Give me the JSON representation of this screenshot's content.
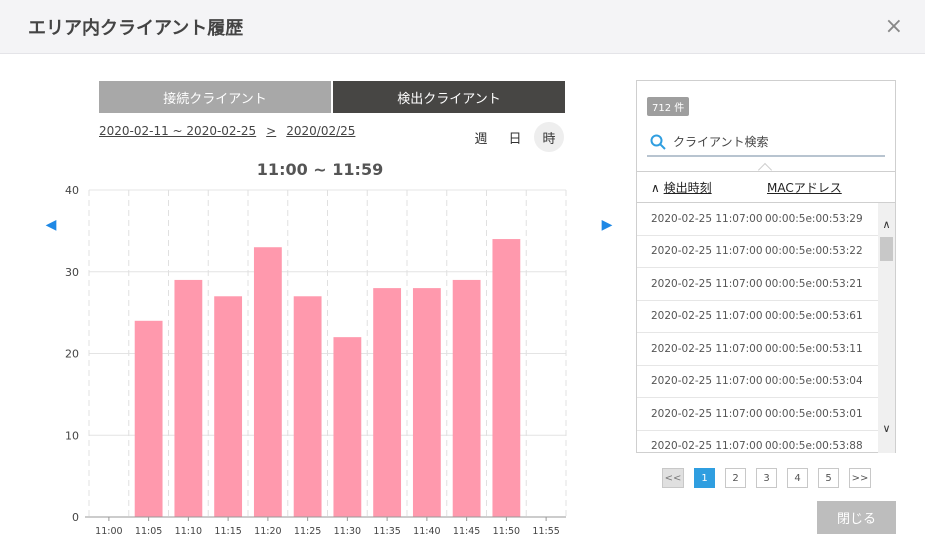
{
  "header": {
    "title": "エリア内クライアント履歴",
    "close_glyph": "×"
  },
  "tabs": [
    {
      "label": "接続クライアント",
      "active": false
    },
    {
      "label": "検出クライアント",
      "active": true
    }
  ],
  "daterange": {
    "range": "2020-02-11 ~ 2020-02-25",
    "separator": ">",
    "date": "2020/02/25"
  },
  "granularity": [
    {
      "label": "週",
      "active": false
    },
    {
      "label": "日",
      "active": false
    },
    {
      "label": "時",
      "active": true
    }
  ],
  "nav": {
    "prev_glyph": "◀",
    "next_glyph": "▶"
  },
  "chart_data": {
    "type": "bar",
    "title": "11:00 ~ 11:59",
    "categories": [
      "11:00",
      "11:05",
      "11:10",
      "11:15",
      "11:20",
      "11:25",
      "11:30",
      "11:35",
      "11:40",
      "11:45",
      "11:50",
      "11:55"
    ],
    "values": [
      0,
      24,
      29,
      27,
      33,
      27,
      22,
      28,
      28,
      29,
      34,
      0
    ],
    "yticks": [
      "0",
      "10",
      "20",
      "30",
      "40"
    ],
    "ylim": [
      0,
      40
    ],
    "xlabel": "",
    "ylabel": "",
    "grid": true,
    "bar_color": "#ff99ad"
  },
  "panel": {
    "count_badge": "712 件",
    "search_placeholder": "クライアント検索",
    "col_time_arrow": "∧",
    "col_time": "検出時刻",
    "col_mac": "MACアドレス",
    "rows": [
      {
        "time": "2020-02-25 11:07:00",
        "mac": "00:00:5e:00:53:29"
      },
      {
        "time": "2020-02-25 11:07:00",
        "mac": "00:00:5e:00:53:22"
      },
      {
        "time": "2020-02-25 11:07:00",
        "mac": "00:00:5e:00:53:21"
      },
      {
        "time": "2020-02-25 11:07:00",
        "mac": "00:00:5e:00:53:61"
      },
      {
        "time": "2020-02-25 11:07:00",
        "mac": "00:00:5e:00:53:11"
      },
      {
        "time": "2020-02-25 11:07:00",
        "mac": "00:00:5e:00:53:04"
      },
      {
        "time": "2020-02-25 11:07:00",
        "mac": "00:00:5e:00:53:01"
      },
      {
        "time": "2020-02-25 11:07:00",
        "mac": "00:00:5e:00:53:88"
      }
    ],
    "scroll_up": "∧",
    "scroll_down": "∨"
  },
  "pager": {
    "prev": "<<",
    "pages": [
      "1",
      "2",
      "3",
      "4",
      "5"
    ],
    "next": ">>",
    "current": "1"
  },
  "footer": {
    "close_label": "閉じる"
  },
  "colors": {
    "accent": "#2f9ee0",
    "arrow": "#1e88e5",
    "tab_active": "#474644",
    "tab_inactive": "#a8a8a8"
  }
}
